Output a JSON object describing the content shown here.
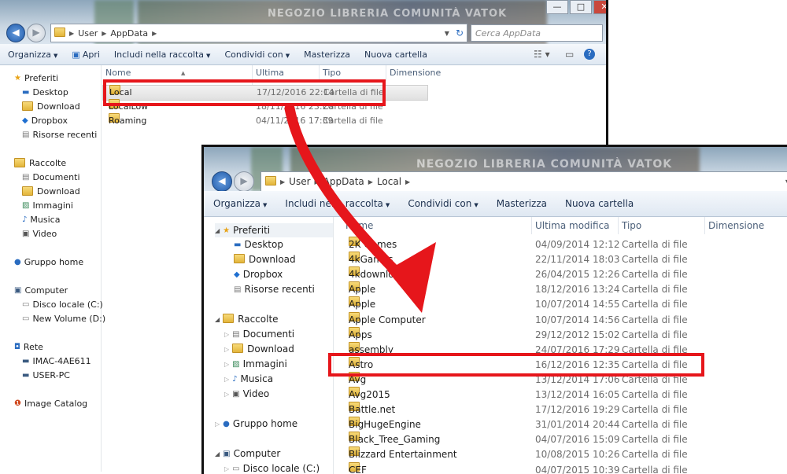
{
  "win1": {
    "blur_text": "NEGOZIO LIBRERIA COMUNITÀ VATOK",
    "controls": [
      "—",
      "□",
      "✕"
    ],
    "breadcrumb": [
      "User",
      "AppData"
    ],
    "search_placeholder": "Cerca AppData",
    "toolbar": [
      "Organizza",
      "Apri",
      "Includi nella raccolta",
      "Condividi con",
      "Masterizza",
      "Nuova cartella"
    ],
    "nav": {
      "favorites": "Preferiti",
      "favorite_items": [
        "Desktop",
        "Download",
        "Dropbox",
        "Risorse recenti"
      ],
      "libraries": "Raccolte",
      "library_items": [
        "Documenti",
        "Download",
        "Immagini",
        "Musica",
        "Video"
      ],
      "homegroup": "Gruppo home",
      "computer": "Computer",
      "computer_items": [
        "Disco locale (C:)",
        "New Volume (D:)"
      ],
      "network": "Rete",
      "network_items": [
        "IMAC-4AE611",
        "USER-PC"
      ],
      "catalog": "Image Catalog"
    },
    "columns": [
      "Nome",
      "Ultima modifica",
      "Tipo",
      "Dimensione"
    ],
    "rows": [
      {
        "name": "Local",
        "date": "17/12/2016 22:14",
        "type": "Cartella di file"
      },
      {
        "name": "LocalLow",
        "date": "18/11/2016 23:20",
        "type": "Cartella di file"
      },
      {
        "name": "Roaming",
        "date": "04/11/2016 17:39",
        "type": "Cartella di file"
      }
    ]
  },
  "win2": {
    "blur_text": "NEGOZIO LIBRERIA COMUNITÀ VATOK",
    "breadcrumb": [
      "User",
      "AppData",
      "Local"
    ],
    "toolbar": [
      "Organizza",
      "Includi nella raccolta",
      "Condividi con",
      "Masterizza",
      "Nuova cartella"
    ],
    "nav": {
      "favorites": "Preferiti",
      "favorite_items": [
        "Desktop",
        "Download",
        "Dropbox",
        "Risorse recenti"
      ],
      "libraries": "Raccolte",
      "library_items": [
        "Documenti",
        "Download",
        "Immagini",
        "Musica",
        "Video"
      ],
      "homegroup": "Gruppo home",
      "computer": "Computer",
      "computer_items": [
        "Disco locale (C:)"
      ]
    },
    "columns": [
      "Nome",
      "Ultima modifica",
      "Tipo",
      "Dimensione"
    ],
    "rows": [
      {
        "name": "2K Games",
        "date": "04/09/2014 12:12",
        "type": "Cartella di file"
      },
      {
        "name": "4kGames",
        "date": "22/11/2014 18:03",
        "type": "Cartella di file"
      },
      {
        "name": "4kdownload.com",
        "date": "26/04/2015 12:26",
        "type": "Cartella di file"
      },
      {
        "name": "Apple",
        "date": "18/12/2016 13:24",
        "type": "Cartella di file"
      },
      {
        "name": "Apple",
        "date": "10/07/2014 14:55",
        "type": "Cartella di file"
      },
      {
        "name": "Apple Computer",
        "date": "10/07/2014 14:56",
        "type": "Cartella di file"
      },
      {
        "name": "Apps",
        "date": "29/12/2012 15:02",
        "type": "Cartella di file"
      },
      {
        "name": "assembly",
        "date": "24/07/2016 17:29",
        "type": "Cartella di file"
      },
      {
        "name": "Astro",
        "date": "16/12/2016 12:35",
        "type": "Cartella di file"
      },
      {
        "name": "Avg",
        "date": "13/12/2014 17:06",
        "type": "Cartella di file"
      },
      {
        "name": "Avg2015",
        "date": "13/12/2014 16:05",
        "type": "Cartella di file"
      },
      {
        "name": "Battle.net",
        "date": "17/12/2016 19:29",
        "type": "Cartella di file"
      },
      {
        "name": "BigHugeEngine",
        "date": "31/01/2014 20:44",
        "type": "Cartella di file"
      },
      {
        "name": "Black_Tree_Gaming",
        "date": "04/07/2016 15:09",
        "type": "Cartella di file"
      },
      {
        "name": "Blizzard Entertainment",
        "date": "10/08/2015 10:26",
        "type": "Cartella di file"
      },
      {
        "name": "CEF",
        "date": "04/07/2015 10:39",
        "type": "Cartella di file"
      }
    ]
  },
  "colors": {
    "highlight": "#e6161b"
  }
}
